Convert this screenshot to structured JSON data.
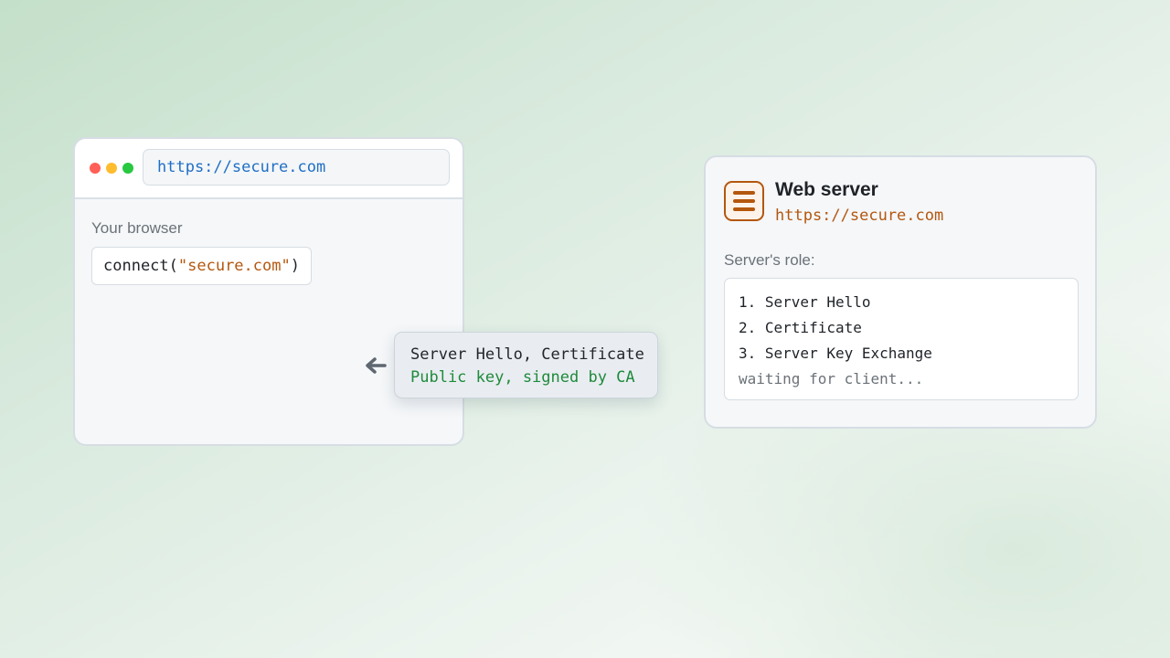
{
  "browser": {
    "url": "https://secure.com",
    "label": "Your browser",
    "code_prefix": "connect(",
    "code_arg": "\"secure.com\"",
    "code_suffix": ")"
  },
  "message": {
    "direction_icon": "arrow-left-icon",
    "line1": "Server Hello, Certificate",
    "line2": "Public key, signed by CA"
  },
  "server": {
    "icon": "server-icon",
    "title": "Web server",
    "url": "https://secure.com",
    "role_label": "Server's role:",
    "steps": [
      "1. Server Hello",
      "2. Certificate",
      "3. Server Key Exchange"
    ],
    "waiting": "waiting for client..."
  },
  "colors": {
    "link_blue": "#1f6fc5",
    "accent_orange": "#b4570e",
    "success_green": "#1f8a3b",
    "muted_gray": "#6b7278",
    "window_red": "#ff5f57",
    "window_yellow": "#febc2e",
    "window_green": "#28c840"
  }
}
